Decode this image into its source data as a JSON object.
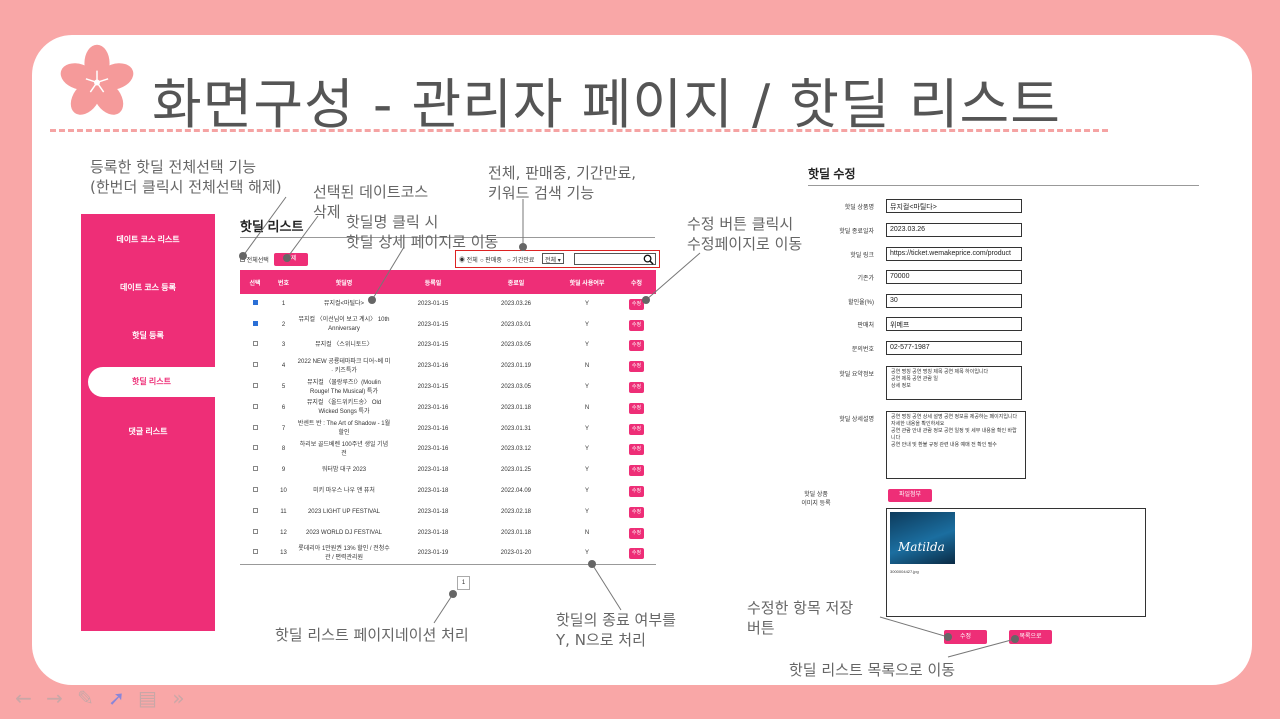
{
  "page_title": "화면구성 -  관리자 페이지 / 핫딜 리스트",
  "annotations": {
    "select_all_1": "등록한 핫딜 전체선택 기능",
    "select_all_2": "(한번더 클릭시 전체선택 해제)",
    "delete_1": "선택된 데이트코스",
    "delete_2": "삭제",
    "name_click_1": "핫딜명 클릭 시",
    "name_click_2": "핫딜 상세 페이지로 이동",
    "filter_1": "전체, 판매중, 기간만료,",
    "filter_2": "키워드 검색 기능",
    "edit_click_1": "수정 버튼 클릭시",
    "edit_click_2": "수정페이지로 이동",
    "pagination": "핫딜 리스트 페이지네이션 처리",
    "endyn_1": "핫딜의 종료 여부를",
    "endyn_2": "Y, N으로 처리",
    "save_1": "수정한 항목 저장",
    "save_2": "버튼",
    "tolist": "핫딜 리스트 목록으로 이동"
  },
  "sidebar": {
    "items": [
      "데이트 코스 리스트",
      "데이트 코스 등록",
      "핫딜 등록",
      "핫딜 리스트",
      "댓글 리스트"
    ],
    "active_index": 3
  },
  "list": {
    "title": "핫딜 리스트",
    "select_all_label": "전체선택",
    "delete_label": "삭제",
    "filters": [
      "전체",
      "판매중",
      "기간만료"
    ],
    "filter_select": "전체",
    "headers": [
      "선택",
      "번호",
      "핫딜명",
      "등록일",
      "종료일",
      "핫딜 사용여부",
      "수정"
    ],
    "edit_label": "수정",
    "rows": [
      {
        "checked": true,
        "no": "1",
        "name": "뮤지컬<마틸다>",
        "reg": "2023-01-15",
        "end": "2023.03.26",
        "yn": "Y"
      },
      {
        "checked": true,
        "no": "2",
        "name": "뮤지컬 〈이선님이 보고 계시〉 10th Anniversary",
        "reg": "2023-01-15",
        "end": "2023.03.01",
        "yn": "Y"
      },
      {
        "checked": false,
        "no": "3",
        "name": "뮤지컬 〈스위니토드〉",
        "reg": "2023-01-15",
        "end": "2023.03.05",
        "yn": "Y"
      },
      {
        "checked": false,
        "no": "4",
        "name": "2022 NEW 공룡테마파크 디어~베 미 · 키즈특가",
        "reg": "2023-01-16",
        "end": "2023.01.19",
        "yn": "N"
      },
      {
        "checked": false,
        "no": "5",
        "name": "뮤지컬 〈물랑루즈!〉(Moulin Rouge! The Musical) 특가",
        "reg": "2023-01-15",
        "end": "2023.03.05",
        "yn": "Y"
      },
      {
        "checked": false,
        "no": "6",
        "name": "뮤지컬 〈올드위키드송〉 Old Wicked Songs 특가",
        "reg": "2023-01-16",
        "end": "2023.01.18",
        "yn": "N"
      },
      {
        "checked": false,
        "no": "7",
        "name": "반센트 반 : The Art of Shadow - 1월 할인",
        "reg": "2023-01-16",
        "end": "2023.01.31",
        "yn": "Y"
      },
      {
        "checked": false,
        "no": "8",
        "name": "하리보 골드베렌 100주년 생일 기념 전",
        "reg": "2023-01-16",
        "end": "2023.03.12",
        "yn": "Y"
      },
      {
        "checked": false,
        "no": "9",
        "name": "워터밤 대구 2023",
        "reg": "2023-01-18",
        "end": "2023.01.25",
        "yn": "Y"
      },
      {
        "checked": false,
        "no": "10",
        "name": "미키 마우스 나우 앤 퓨처",
        "reg": "2023-01-18",
        "end": "2022.04.09",
        "yn": "Y"
      },
      {
        "checked": false,
        "no": "11",
        "name": "2023 LIGHT UP FESTIVAL",
        "reg": "2023-01-18",
        "end": "2023.02.18",
        "yn": "Y"
      },
      {
        "checked": false,
        "no": "12",
        "name": "2023 WORLD DJ FESTIVAL",
        "reg": "2023-01-18",
        "end": "2023.01.18",
        "yn": "N"
      },
      {
        "checked": false,
        "no": "13",
        "name": "롯데리아 1만원권 13% 할인 / 전청수관 / 편력관리원",
        "reg": "2023-01-19",
        "end": "2023-01-20",
        "yn": "Y"
      }
    ],
    "page": "1"
  },
  "edit": {
    "title": "핫딜 수정",
    "fields": [
      {
        "label": "핫딜 상품명",
        "value": "뮤지컬<마틸다>"
      },
      {
        "label": "핫딜 종료일자",
        "value": "2023.03.26"
      },
      {
        "label": "핫딜 링크",
        "value": "https://ticket.wemakeprice.com/product"
      },
      {
        "label": "기존가",
        "value": "70000"
      },
      {
        "label": "할인율(%)",
        "value": "30"
      },
      {
        "label": "판매처",
        "value": "위메프"
      },
      {
        "label": "문의번호",
        "value": "02-577-1987"
      }
    ],
    "summary_label": "핫딜 요약정보",
    "summary_text": "공연 명칭 공연 명칭 제목 공연 제목 하이입니다\n공연 제목 공연 관람 일\n상세 정보",
    "detail_label": "핫딜 상세설명",
    "detail_text": "공연 명칭 공연 상세 설명 공연 정보를 제공하는 페이지입니다 자세한 내용을 확인하세요\n공연 관람 안내 관람 정보 공연 일정 및 세부 내용을 확인 바랍니다\n공연 안내 및 환불 규정 관련 내용 예매 전 확인 필수",
    "image_label_1": "핫딜 상품",
    "image_label_2": "이미지 등록",
    "attach_label": "파일첨부",
    "poster_text": "Matilda",
    "image_filename": "3000004427.jpg",
    "save_label": "수정",
    "list_label": "목록으로"
  },
  "colors": {
    "accent": "#ee2e77",
    "background": "#f9a7a7"
  }
}
